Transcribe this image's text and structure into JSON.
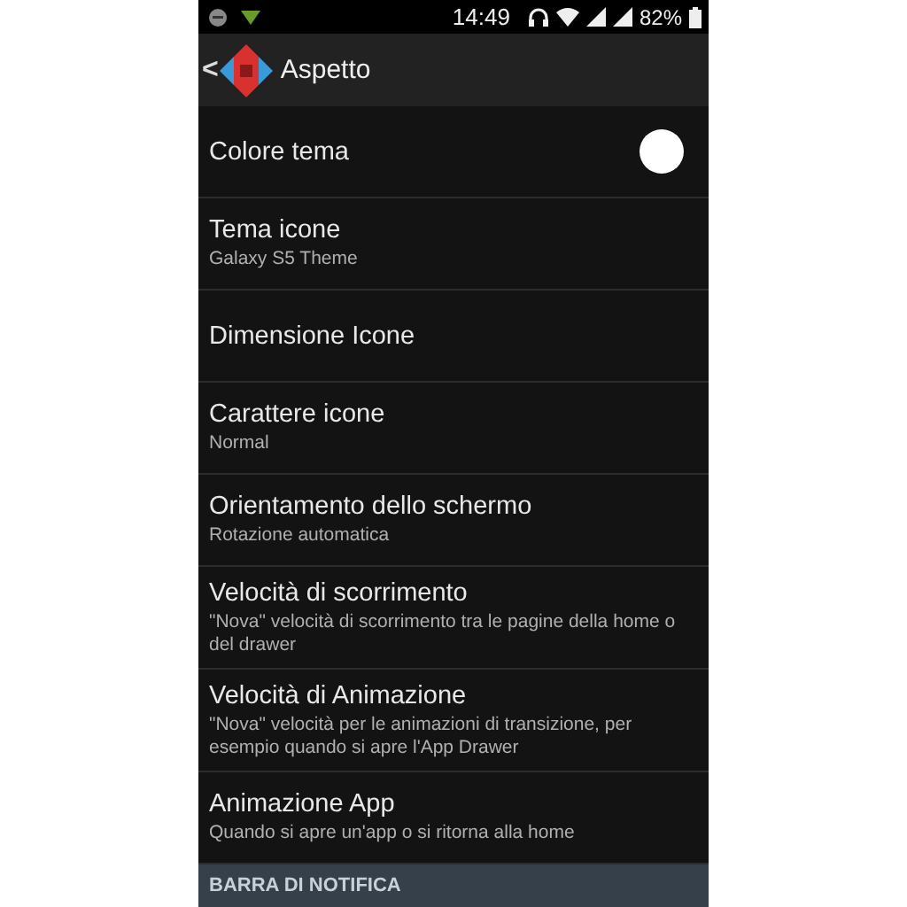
{
  "status_bar": {
    "time": "14:49",
    "battery": "82%"
  },
  "action_bar": {
    "back": "<",
    "title": "Aspetto"
  },
  "items": [
    {
      "kind": "swatch",
      "title": "Colore tema",
      "color": "#ffffff"
    },
    {
      "kind": "text",
      "title": "Tema icone",
      "summary": "Galaxy S5 Theme"
    },
    {
      "kind": "text",
      "title": "Dimensione Icone"
    },
    {
      "kind": "text",
      "title": "Carattere icone",
      "summary": "Normal"
    },
    {
      "kind": "text",
      "title": "Orientamento dello schermo",
      "summary": "Rotazione automatica"
    },
    {
      "kind": "text",
      "title": "Velocità di scorrimento",
      "summary": "\"Nova\" velocità di scorrimento tra le pagine della home o del drawer"
    },
    {
      "kind": "text",
      "title": "Velocità di Animazione",
      "summary": "\"Nova\" velocità per le animazioni di transizione, per esempio quando si apre l'App Drawer"
    },
    {
      "kind": "text",
      "title": "Animazione App",
      "summary": "Quando si apre un'app o si ritorna alla home"
    }
  ],
  "section_header": "BARRA DI NOTIFICA"
}
